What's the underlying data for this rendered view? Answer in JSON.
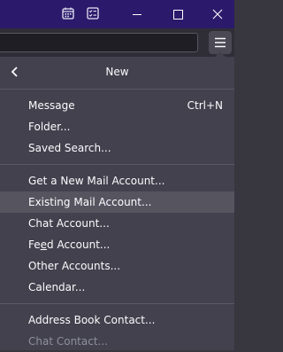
{
  "colors": {
    "titlebar": "#2b1a6b",
    "panel": "#42414d",
    "hover": "#56555f",
    "text": "#fbfbfe",
    "disabled_text": "#8f8f9d"
  },
  "titlebar": {
    "icons": [
      "calendar-icon",
      "tasks-icon",
      "minimize-icon",
      "maximize-icon",
      "close-icon"
    ]
  },
  "toolbar": {
    "search_value": "",
    "menu_icon": "hamburger-menu-icon"
  },
  "panel": {
    "title": "New",
    "back_icon": "chevron-left-icon",
    "items": [
      {
        "label": "Message",
        "shortcut": "Ctrl+N"
      },
      {
        "label": "Folder..."
      },
      {
        "label": "Saved Search..."
      },
      {
        "label": "Get a New Mail Account..."
      },
      {
        "label": "Existing Mail Account...",
        "state": "hover"
      },
      {
        "label": "Chat Account..."
      },
      {
        "label_pre": "Fe",
        "label_key": "e",
        "label_post": "d Account...",
        "label": "Feed Account..."
      },
      {
        "label": "Other Accounts..."
      },
      {
        "label": "Calendar..."
      },
      {
        "label": "Address Book Contact..."
      },
      {
        "label": "Chat Contact...",
        "state": "disabled"
      }
    ]
  }
}
